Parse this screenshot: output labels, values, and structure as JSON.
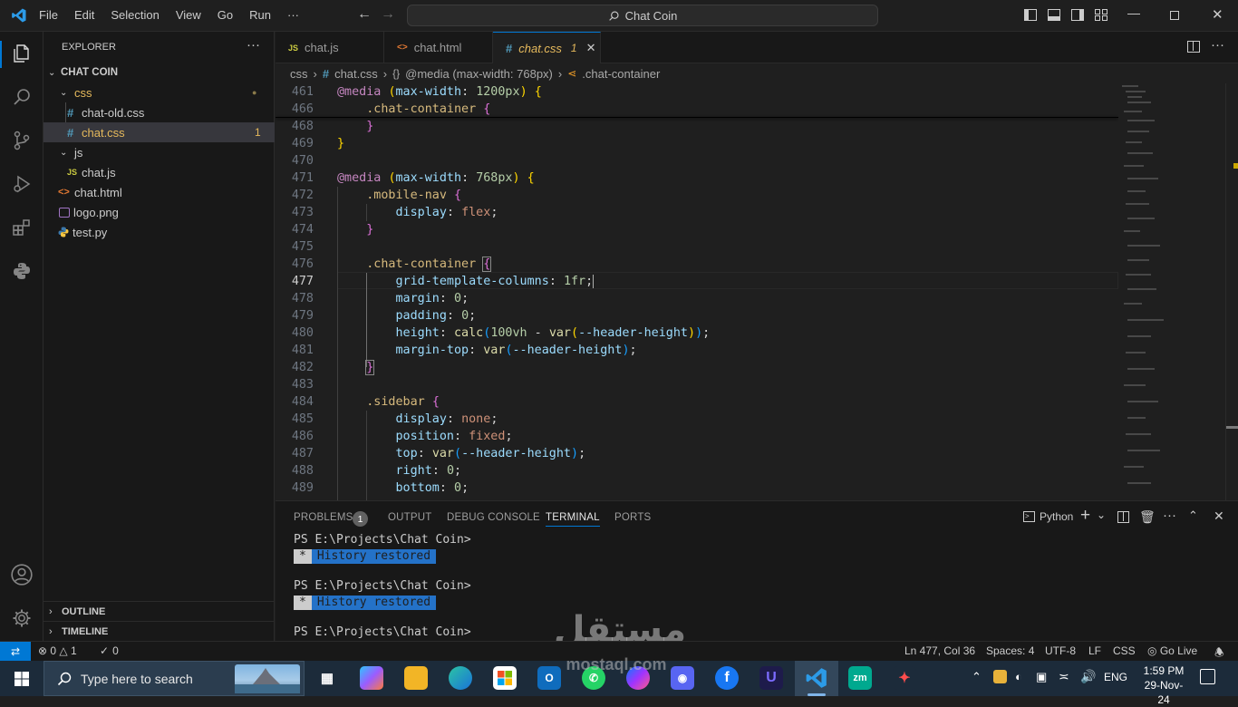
{
  "titlebar": {
    "menu": [
      "File",
      "Edit",
      "Selection",
      "View",
      "Go",
      "Run",
      "···"
    ],
    "search_text": "Chat Coin"
  },
  "sidebar": {
    "title": "EXPLORER",
    "more": "···",
    "project": "CHAT COIN",
    "tree": [
      {
        "label": "css",
        "type": "folder",
        "badge": "●"
      },
      {
        "label": "chat-old.css",
        "type": "css"
      },
      {
        "label": "chat.css",
        "type": "css",
        "badge": "1"
      },
      {
        "label": "js",
        "type": "folder"
      },
      {
        "label": "chat.js",
        "type": "js"
      },
      {
        "label": "chat.html",
        "type": "html"
      },
      {
        "label": "logo.png",
        "type": "png"
      },
      {
        "label": "test.py",
        "type": "py"
      }
    ],
    "outline": "OUTLINE",
    "timeline": "TIMELINE"
  },
  "tabs": [
    {
      "label": "chat.js",
      "icon": "JS"
    },
    {
      "label": "chat.html",
      "icon": "<>"
    },
    {
      "label": "chat.css",
      "icon": "#",
      "badge": "1",
      "close": "✕"
    }
  ],
  "breadcrumb": {
    "parts": [
      "css",
      "chat.css",
      "@media (max-width: 768px)",
      ".chat-container"
    ]
  },
  "code": {
    "current_line": "477",
    "lines": [
      {
        "n": "461",
        "text": "@media (max-width: 1200px) {"
      },
      {
        "n": "466",
        "text": "    .chat-container {"
      },
      {
        "n": "468",
        "text": "    }"
      },
      {
        "n": "469",
        "text": "}"
      },
      {
        "n": "470",
        "text": ""
      },
      {
        "n": "471",
        "text": "@media (max-width: 768px) {"
      },
      {
        "n": "472",
        "text": "    .mobile-nav {"
      },
      {
        "n": "473",
        "text": "        display: flex;"
      },
      {
        "n": "474",
        "text": "    }"
      },
      {
        "n": "475",
        "text": ""
      },
      {
        "n": "476",
        "text": "    .chat-container {"
      },
      {
        "n": "477",
        "text": "        grid-template-columns: 1fr;"
      },
      {
        "n": "478",
        "text": "        margin: 0;"
      },
      {
        "n": "479",
        "text": "        padding: 0;"
      },
      {
        "n": "480",
        "text": "        height: calc(100vh - var(--header-height));"
      },
      {
        "n": "481",
        "text": "        margin-top: var(--header-height);"
      },
      {
        "n": "482",
        "text": "    }"
      },
      {
        "n": "483",
        "text": ""
      },
      {
        "n": "484",
        "text": "    .sidebar {"
      },
      {
        "n": "485",
        "text": "        display: none;"
      },
      {
        "n": "486",
        "text": "        position: fixed;"
      },
      {
        "n": "487",
        "text": "        top: var(--header-height);"
      },
      {
        "n": "488",
        "text": "        right: 0;"
      },
      {
        "n": "489",
        "text": "        bottom: 0;"
      }
    ]
  },
  "panel": {
    "tabs": [
      "PROBLEMS",
      "OUTPUT",
      "DEBUG CONSOLE",
      "TERMINAL",
      "PORTS"
    ],
    "problems_count": "1",
    "active_tab": "TERMINAL",
    "shell": "Python",
    "terminal": {
      "prompt": "PS E:\\Projects\\Chat Coin>",
      "restored_star": "*",
      "restored_msg": "History restored"
    }
  },
  "statusbar": {
    "errors": "0",
    "warnings": "1",
    "ports": "0",
    "position": "Ln 477, Col 36",
    "spaces": "Spaces: 4",
    "encoding": "UTF-8",
    "eol": "LF",
    "language": "CSS",
    "golive": "Go Live"
  },
  "taskbar": {
    "search_placeholder": "Type here to search",
    "time": "1:59 PM",
    "date": "29-Nov-24",
    "lang": "ENG"
  },
  "watermark": {
    "text": "مستقل",
    "sub": "mostaql.com"
  },
  "colors": {
    "accent": "#0078d4",
    "modified": "#e5b95c",
    "editor_bg": "#1f1f1f",
    "side_bg": "#181818"
  }
}
